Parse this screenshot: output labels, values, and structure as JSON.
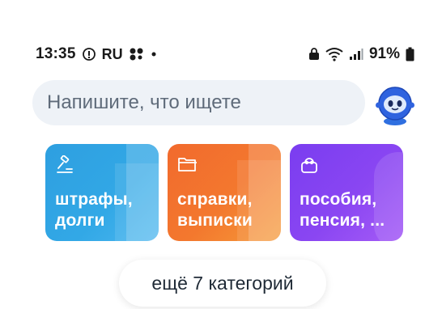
{
  "status_bar": {
    "time": "13:35",
    "carrier_badge": "RU",
    "battery": "91%",
    "icons": [
      "shield-icon",
      "ru-icon",
      "grid-dots-icon",
      "dot-icon",
      "lock-icon",
      "wifi-icon",
      "signal-icon",
      "battery-icon"
    ]
  },
  "search": {
    "placeholder": "Напишите, что ищете"
  },
  "assistant": {
    "icon": "robot-assistant-icon"
  },
  "categories": [
    {
      "id": "fines",
      "icon": "gavel-icon",
      "line1": "штрафы,",
      "line2": "долги",
      "color": "#33a7e5"
    },
    {
      "id": "docs",
      "icon": "folder-icon",
      "line1": "справки,",
      "line2": "выписки",
      "color": "#f47431"
    },
    {
      "id": "benefits",
      "icon": "purse-icon",
      "line1": "пособия,",
      "line2": "пенсия, ...",
      "color": "#8a46f2"
    }
  ],
  "more_button": {
    "label": "ещё 7 категорий"
  }
}
